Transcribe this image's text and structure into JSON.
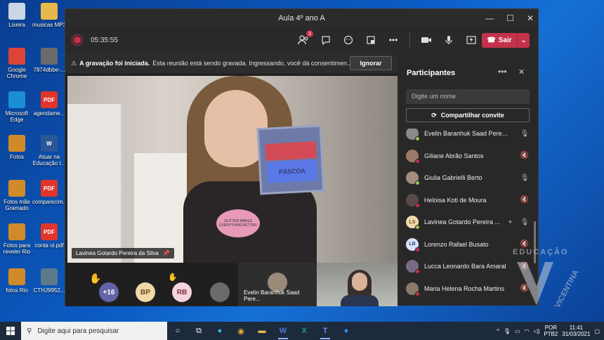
{
  "desktop": {
    "icons": [
      {
        "label": "Lixeira",
        "icon": "recycle-bin-icon",
        "color": "#c9d6e6"
      },
      {
        "label": "musicas MP3",
        "icon": "folder-icon",
        "color": "#e8b84a"
      },
      {
        "label": "Google Chrome",
        "icon": "chrome-icon",
        "color": "#db4437"
      },
      {
        "label": "7874dbbe-...",
        "icon": "image-icon",
        "color": "#6b6b6b"
      },
      {
        "label": "Microsoft Edge",
        "icon": "edge-icon",
        "color": "#1a8fd6"
      },
      {
        "label": "agendame...",
        "icon": "pdf-icon",
        "color": "#e0352b",
        "text": "PDF"
      },
      {
        "label": "Fotos",
        "icon": "photos-icon",
        "color": "#d08a2a"
      },
      {
        "label": "Atuar na Educação I...",
        "icon": "word-icon",
        "color": "#2b5797",
        "text": "W"
      },
      {
        "label": "Fotos mãe Gramado",
        "icon": "photos-icon",
        "color": "#d08a2a"
      },
      {
        "label": "comparecim...",
        "icon": "pdf-icon",
        "color": "#e0352b",
        "text": "PDF"
      },
      {
        "label": "Fotos para reveler Rio",
        "icon": "photos-icon",
        "color": "#d08a2a"
      },
      {
        "label": "conta oi.pdf",
        "icon": "pdf-icon",
        "color": "#e0352b",
        "text": "PDF"
      },
      {
        "label": "fotos Rio",
        "icon": "photos-icon",
        "color": "#d08a2a"
      },
      {
        "label": "CTHJ9952...",
        "icon": "image-icon",
        "color": "#5d7a8a"
      }
    ]
  },
  "window": {
    "title": "Aula 4º ano A",
    "controls": {
      "minimize": "—",
      "maximize": "☐",
      "close": "✕"
    }
  },
  "toolbar": {
    "timer": "05:35:55",
    "participants_badge": "3",
    "leave_label": "Sair"
  },
  "banner": {
    "bold": "A gravação foi iniciada.",
    "text": "Esta reunião está sendo gravada. Ingressando, você dá consentimen...",
    "ignore_label": "Ignorar"
  },
  "video": {
    "speaker_name": "Lavinea Gotardo Pereira da Silva",
    "shirt_text": "GLITTER MAKES EVERYTHING BETTER",
    "card_text": "PÁSCOA"
  },
  "strip": {
    "more_count": "+16",
    "avatars": [
      {
        "initials": "BP",
        "bg": "#f0d9a8",
        "fg": "#6b4b1a"
      },
      {
        "initials": "RB",
        "bg": "#f5d4dc",
        "fg": "#7a2e45"
      }
    ],
    "evelin_name": "Evelin Baranhuk Saad Pere..."
  },
  "panel": {
    "title": "Participantes",
    "search_placeholder": "Digite um nome",
    "share_label": "Compartilhar convite",
    "participants": [
      {
        "name": "Evelin Baranhuk Saad Pereira",
        "initials": "",
        "bg": "#8a8a8a",
        "mic": "on"
      },
      {
        "name": "Giliane Abrão Santos",
        "initials": "",
        "bg": "#9a7a6a",
        "mic": "muted"
      },
      {
        "name": "Giulia Gabrielli Berto",
        "initials": "",
        "bg": "#a58c7a",
        "mic": "on"
      },
      {
        "name": "Heloisa Koti de Moura",
        "initials": "",
        "bg": "#5a4a4a",
        "mic": "muted"
      },
      {
        "name": "Lavinea Gotardo Pereira ...",
        "initials": "LS",
        "bg": "#f0d9a8",
        "fg": "#6b4b1a",
        "mic": "on",
        "pinned": true
      },
      {
        "name": "Lorenzo Rafael Busato",
        "initials": "LB",
        "bg": "#d6e2f5",
        "fg": "#2c4a7a",
        "mic": "muted"
      },
      {
        "name": "Lucca Leonardo Bara Amaral",
        "initials": "",
        "bg": "#7a6a8a",
        "mic": "muted"
      },
      {
        "name": "Maria Helena Rocha Martins",
        "initials": "",
        "bg": "#8a7a6a",
        "mic": "muted"
      }
    ]
  },
  "watermark": {
    "text": "EDUCAÇÃO",
    "sub": "VICENTINA"
  },
  "taskbar": {
    "search_placeholder": "Digite aqui para pesquisar",
    "lang": "POR",
    "lang_sub": "PTB2",
    "time": "11:41",
    "date": "31/03/2021"
  }
}
